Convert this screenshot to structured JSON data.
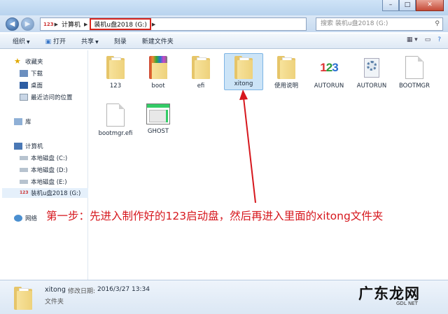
{
  "window": {
    "buttons": [
      "–",
      "□",
      "✕"
    ]
  },
  "nav": {
    "back_icon": "back-arrow-icon",
    "forward_icon": "forward-arrow-icon",
    "breadcrumb": [
      "计算机",
      "装机u盘2018 (G:)"
    ],
    "search_placeholder": "搜索 装机u盘2018 (G:)"
  },
  "toolbar": {
    "organize": "组织",
    "open": "打开",
    "share": "共享",
    "burn": "刻录",
    "new_folder": "新建文件夹"
  },
  "sidebar": {
    "favorites": "收藏夹",
    "favorites_items": [
      "下载",
      "桌面",
      "最近访问的位置"
    ],
    "libraries": "库",
    "computer": "计算机",
    "drives": [
      "本地磁盘 (C:)",
      "本地磁盘 (D:)",
      "本地磁盘 (E:)",
      "装机u盘2018 (G:)"
    ],
    "network": "网络"
  },
  "files": [
    {
      "name": "123",
      "type": "folder"
    },
    {
      "name": "boot",
      "type": "folder-boot"
    },
    {
      "name": "efi",
      "type": "folder"
    },
    {
      "name": "xitong",
      "type": "folder",
      "selected": true
    },
    {
      "name": "使用说明",
      "type": "folder"
    },
    {
      "name": "AUTORUN",
      "type": "app-123"
    },
    {
      "name": "AUTORUN",
      "type": "settings"
    },
    {
      "name": "BOOTMGR",
      "type": "file"
    },
    {
      "name": "bootmgr.efi",
      "type": "file"
    },
    {
      "name": "GHOST",
      "type": "ghost"
    }
  ],
  "annotation": "第一步：先进入制作好的123启动盘，然后再进入里面的xitong文件夹",
  "status": {
    "name": "xitong",
    "modified_label": "修改日期:",
    "modified_value": "2016/3/27 13:34",
    "type": "文件夹"
  },
  "watermark": {
    "text": "广东龙网",
    "sub": "GDL NET"
  },
  "colors": {
    "highlight_box": "#d9251c",
    "annotation": "#d6171d",
    "selection": "#cce4f7"
  }
}
